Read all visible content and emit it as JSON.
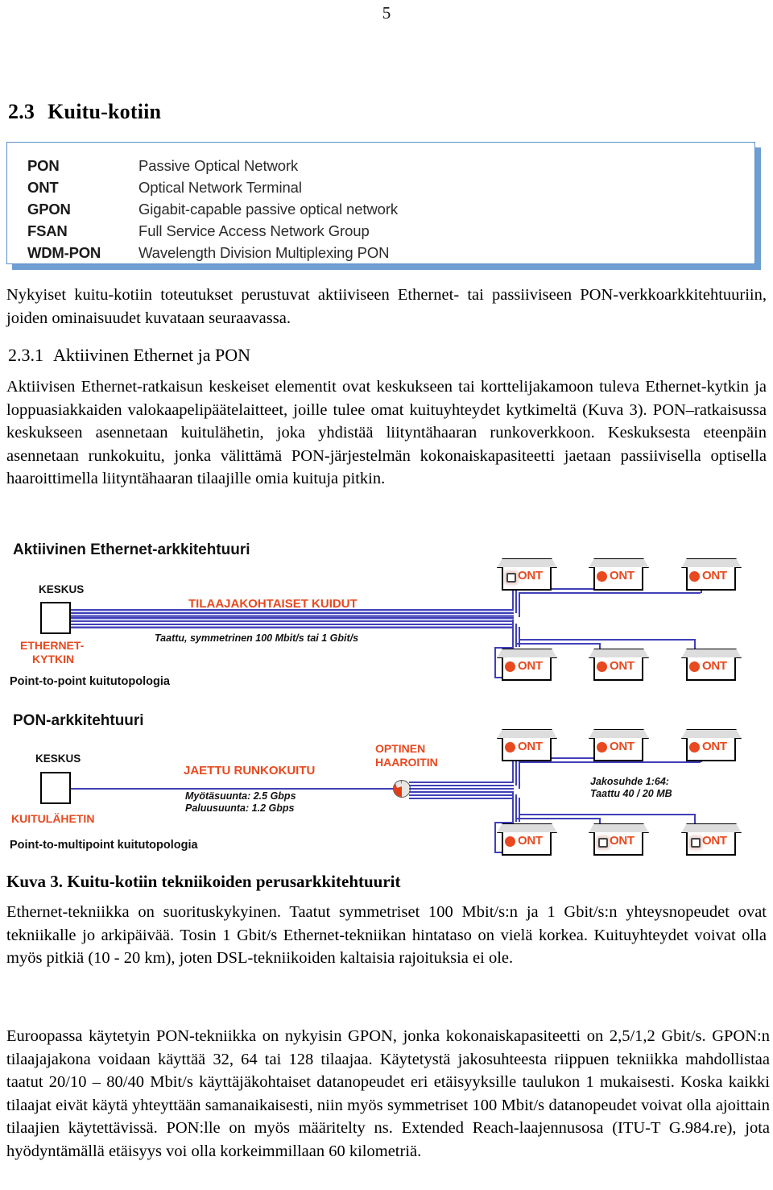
{
  "page": {
    "number": "5"
  },
  "section": {
    "number": "2.3",
    "title": "Kuitu-kotiin"
  },
  "definitions": {
    "rows": [
      {
        "term": "PON",
        "desc": "Passive Optical Network"
      },
      {
        "term": "ONT",
        "desc": "Optical Network Terminal"
      },
      {
        "term": "GPON",
        "desc": "Gigabit-capable passive optical network"
      },
      {
        "term": "FSAN",
        "desc": "Full Service Access Network Group"
      },
      {
        "term": "WDM-PON",
        "desc": "Wavelength Division Multiplexing PON"
      }
    ]
  },
  "paragraphs": {
    "intro": "Nykyiset kuitu-kotiin toteutukset perustuvat aktiiviseen Ethernet- tai passiiviseen PON-verkkoarkkitehtuuriin, joiden ominaisuudet kuvataan seuraavassa.",
    "aktiivinen": "Aktiivisen Ethernet-ratkaisun keskeiset elementit ovat keskukseen tai korttelijakamoon tuleva Ethernet-kytkin ja loppuasiakkaiden valokaapelipäätelaitteet, joille tulee omat kuituyhteydet kytkimeltä (Kuva 3). PON–ratkaisussa keskukseen asennetaan kuitulähetin, joka yhdistää liityntähaaran runkoverkkoon. Keskuksesta eteenpäin asennetaan runkokuitu, jonka välittämä PON-järjestelmän kokonaiskapasiteetti jaetaan passiivisella optisella haaroittimella liityntähaaran tilaajille omia kuituja pitkin.",
    "ethernet_tekniikka": "Ethernet-tekniikka on suorituskykyinen. Taatut symmetriset 100 Mbit/s:n ja 1 Gbit/s:n yhteysnopeudet ovat tekniikalle jo arkipäivää. Tosin 1 Gbit/s Ethernet-tekniikan hintataso on vielä korkea. Kuituyhteydet voivat olla myös pitkiä (10 - 20 km), joten DSL-tekniikoiden kaltaisia rajoituksia ei ole.",
    "euroopassa": "Euroopassa käytetyin PON-tekniikka on nykyisin GPON, jonka kokonaiskapasiteetti on 2,5/1,2 Gbit/s. GPON:n tilaajajakona voidaan käyttää 32, 64 tai 128 tilaajaa. Käytetystä jakosuhteesta riippuen tekniikka mahdollistaa taatut 20/10 – 80/40 Mbit/s käyttäjäkohtaiset datanopeudet eri etäisyyksille taulukon 1 mukaisesti. Koska kaikki tilaajat eivät käytä yhteyttään samanaikaisesti, niin myös symmetriset 100 Mbit/s datanopeudet voivat olla ajoittain tilaajien käytettävissä. PON:lle on myös määritelty ns. Extended Reach-laajennusosa (ITU-T G.984.re), jota hyödyntämällä etäisyys voi olla korkeimmillaan 60 kilometriä."
  },
  "subsection": {
    "number": "2.3.1",
    "title": "Aktiivinen Ethernet ja PON"
  },
  "figure": {
    "caption": "Kuva 3. Kuitu-kotiin tekniikoiden perusarkkitehtuurit",
    "ethernet": {
      "title": "Aktiivinen Ethernet-arkkitehtuuri",
      "keskus_label": "KESKUS",
      "device_label_line1": "ETHERNET-",
      "device_label_line2": "KYTKIN",
      "fiber_label": "TILAAJAKOHTAISET KUIDUT",
      "speed_note": "Taattu, symmetrinen 100 Mbit/s tai 1 Gbit/s",
      "topology": "Point-to-point kuitutopologia",
      "ont_label": "ONT",
      "ont_count": 6
    },
    "pon": {
      "title": "PON-arkkitehtuuri",
      "keskus_label": "KESKUS",
      "device_label": "KUITULÄHETIN",
      "fiber_label": "JAETTU RUNKOKUITU",
      "speed_note_line1": "Myötäsuunta: 2.5 Gbps",
      "speed_note_line2": "Paluusuunta: 1.2 Gbps",
      "splitter_label_line1": "OPTINEN",
      "splitter_label_line2": "HAAROITIN",
      "split_note_line1": "Jakosuhde 1:64:",
      "split_note_line2": "Taattu 40 / 20 MB",
      "topology": "Point-to-multipoint kuitutopologia",
      "ont_label": "ONT",
      "ont_count": 6
    }
  },
  "colors": {
    "accent_red": "#E8491F",
    "fiber_blue": "#4040b8",
    "box_border_blue": "#5b8fc9",
    "box_shadow_blue": "#6f9fd2"
  }
}
